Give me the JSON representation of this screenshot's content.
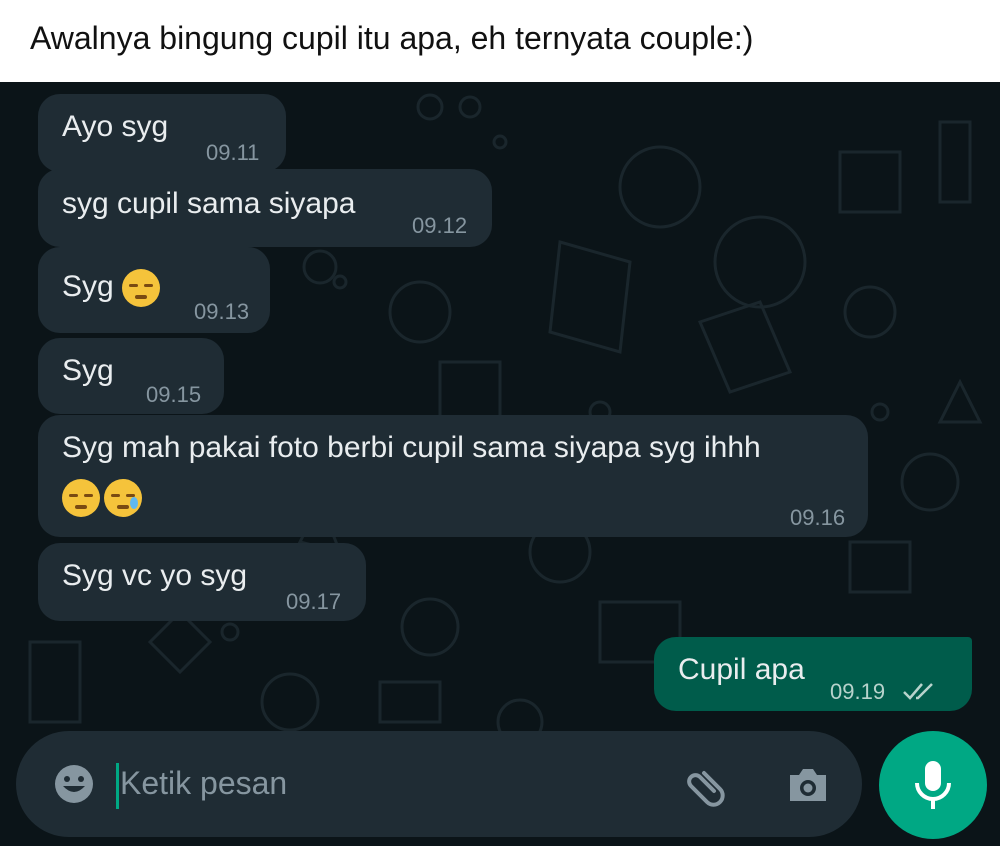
{
  "caption": "Awalnya bingung cupil itu apa, eh ternyata couple:)",
  "messages": [
    {
      "text": "Ayo syg",
      "time": "09.11"
    },
    {
      "text": "syg cupil sama siyapa",
      "time": "09.12"
    },
    {
      "text": "Syg",
      "time": "09.13",
      "emojis": [
        "pensive-face"
      ]
    },
    {
      "text": "Syg",
      "time": "09.15"
    },
    {
      "text": "Syg mah pakai foto berbi cupil sama siyapa syg ihhh",
      "time": "09.16",
      "emojis": [
        "pensive-face",
        "crying-face"
      ]
    },
    {
      "text": "Syg vc yo syg",
      "time": "09.17"
    },
    {
      "text": "Cupil apa",
      "time": "09.19",
      "status": "read-double-check"
    }
  ],
  "input": {
    "placeholder": "Ketik pesan"
  },
  "icons": {
    "emoji": "emoji-icon",
    "attach": "paperclip-icon",
    "camera": "camera-icon",
    "mic": "microphone-icon"
  },
  "colors": {
    "chat_background": "#0b1418",
    "incoming_bubble": "#1f2c34",
    "outgoing_bubble": "#005c4b",
    "accent": "#00a884"
  }
}
